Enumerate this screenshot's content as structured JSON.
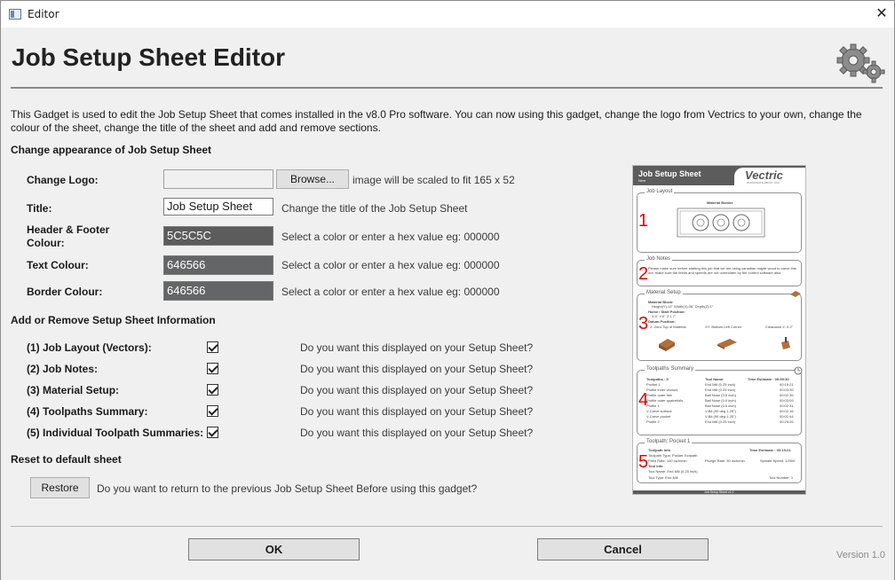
{
  "window": {
    "title": "Editor",
    "close_glyph": "✕"
  },
  "header": {
    "title": "Job Setup Sheet Editor",
    "icon": "gears-icon"
  },
  "intro": "This Gadget is used to edit the Job Setup Sheet that comes installed in the v8.0 Pro software. You can now using this gadget, change the logo from Vectrics to your own, change the colour of the sheet, change the title of the sheet and add and remove sections.",
  "appearance": {
    "heading": "Change appearance of Job Setup Sheet",
    "logo_label": "Change Logo:",
    "logo_value": "",
    "browse_label": "Browse...",
    "logo_hint": "image will be scaled to fit 165 x 52",
    "title_label": "Title:",
    "title_value": "Job Setup Sheet",
    "title_hint": "Change the title of the Job Setup Sheet",
    "header_footer_label_1": "Header & Footer",
    "header_footer_label_2": "Colour:",
    "header_footer_value": "5C5C5C",
    "header_footer_color": "#5C5C5C",
    "header_footer_hint": "Select a color or enter a hex value eg: 000000",
    "text_colour_label": "Text Colour:",
    "text_colour_value": "646566",
    "text_colour_color": "#646566",
    "text_colour_hint": "Select a color or enter a hex value eg: 000000",
    "border_colour_label": "Border Colour:",
    "border_colour_value": "646566",
    "border_colour_color": "#646566",
    "border_colour_hint": "Select a color or enter a hex value eg: 000000"
  },
  "sections": {
    "heading": "Add or Remove Setup Sheet Information",
    "items": [
      {
        "label": "(1) Job Layout (Vectors):",
        "checked": true,
        "hint": "Do you want this displayed on your Setup Sheet?"
      },
      {
        "label": "(2) Job Notes:",
        "checked": true,
        "hint": "Do you want this displayed on your Setup Sheet?"
      },
      {
        "label": "(3) Material Setup:",
        "checked": true,
        "hint": "Do you want this displayed on your Setup Sheet?"
      },
      {
        "label": "(4) Toolpaths Summary:",
        "checked": true,
        "hint": "Do you want this displayed on your Setup Sheet?"
      },
      {
        "label": "(5) Individual Toolpath Summaries:",
        "checked": true,
        "hint": "Do you want this displayed on your Setup Sheet?"
      }
    ]
  },
  "reset": {
    "heading": "Reset to default sheet",
    "restore_label": "Restore",
    "restore_hint": "Do you want to return to the previous Job Setup Sheet Before using this gadget?"
  },
  "footer": {
    "ok_label": "OK",
    "cancel_label": "Cancel",
    "version": "Version 1.0"
  },
  "preview": {
    "title": "Job Setup Sheet",
    "subtitle": "New",
    "logo_text": "Vectric",
    "logo_sub": "PASSIONATE ABOUT CNC",
    "box1_title": "Job Layout",
    "box1_caption": "Material Border",
    "box2_title": "Job Notes",
    "box2_text": "Please make sure before starting this job that we are using canadian maple wood to carve this out, make sure the feeds and speeds are not overridden by the control software also.",
    "box3_title": "Material Setup",
    "box3_lines": [
      "Material Block:",
      "Height(Y):12\" Width(X):36\" Depth(Z):1\"",
      "Home / Start Position:",
      "X:0\" Y:0\" Z:1.7\"",
      "Datum Position:",
      "Z: Zero-Top of Material",
      "XY: Bottom Left Corner",
      "Clearance Z: 0.2\""
    ],
    "box4_title": "Toolpaths Summary",
    "box4_header": [
      "Toolpaths : 5",
      "Tool Name:",
      "Time Estimate : 00:59:30"
    ],
    "box4_rows": [
      [
        "Pocket 1",
        "End Mill (0.25 inch)",
        "00:15:21"
      ],
      [
        "Profile inner vectors",
        "End Mill (0.25 inch)",
        "00:03:35"
      ],
      [
        "Profile outer fixb",
        "Ball Nose (0.5 inch)",
        "00:02:35"
      ],
      [
        "Profile outer quatrefoils",
        "Ball Nose (0.5 inch)",
        "00:03:09"
      ],
      [
        "Profile 1",
        "Ball Nose (0.5 inch)",
        "00:02:31"
      ],
      [
        "V-Carve surface",
        "V-Bit (90 deg 1.25\")",
        "00:02:16"
      ],
      [
        "V-Carve pocket",
        "V-Bit (90 deg 1.25\")",
        "00:01:44"
      ],
      [
        "Profile 2",
        "End Mill (0.25 inch)",
        "00:25:26"
      ]
    ],
    "box5_title": "Toolpath: Pocket 1",
    "box5_lines": [
      "Toolpath Info",
      "Time Estimate : 00:15:21",
      "Toolpath Type: Pocket Toolpath",
      "Feed Rate: 100 inch/min",
      "Plunge Rate: 30 inch/min",
      "Spindle Speed: 12000",
      "Tool Info",
      "Tool Name: End Mill (0.25 inch)",
      "Tool Type: End Mill",
      "Tool Number: 1"
    ],
    "footer_text": "Job Setup Sheet v1.0",
    "numbers": [
      "1",
      "2",
      "3",
      "4",
      "5"
    ]
  }
}
